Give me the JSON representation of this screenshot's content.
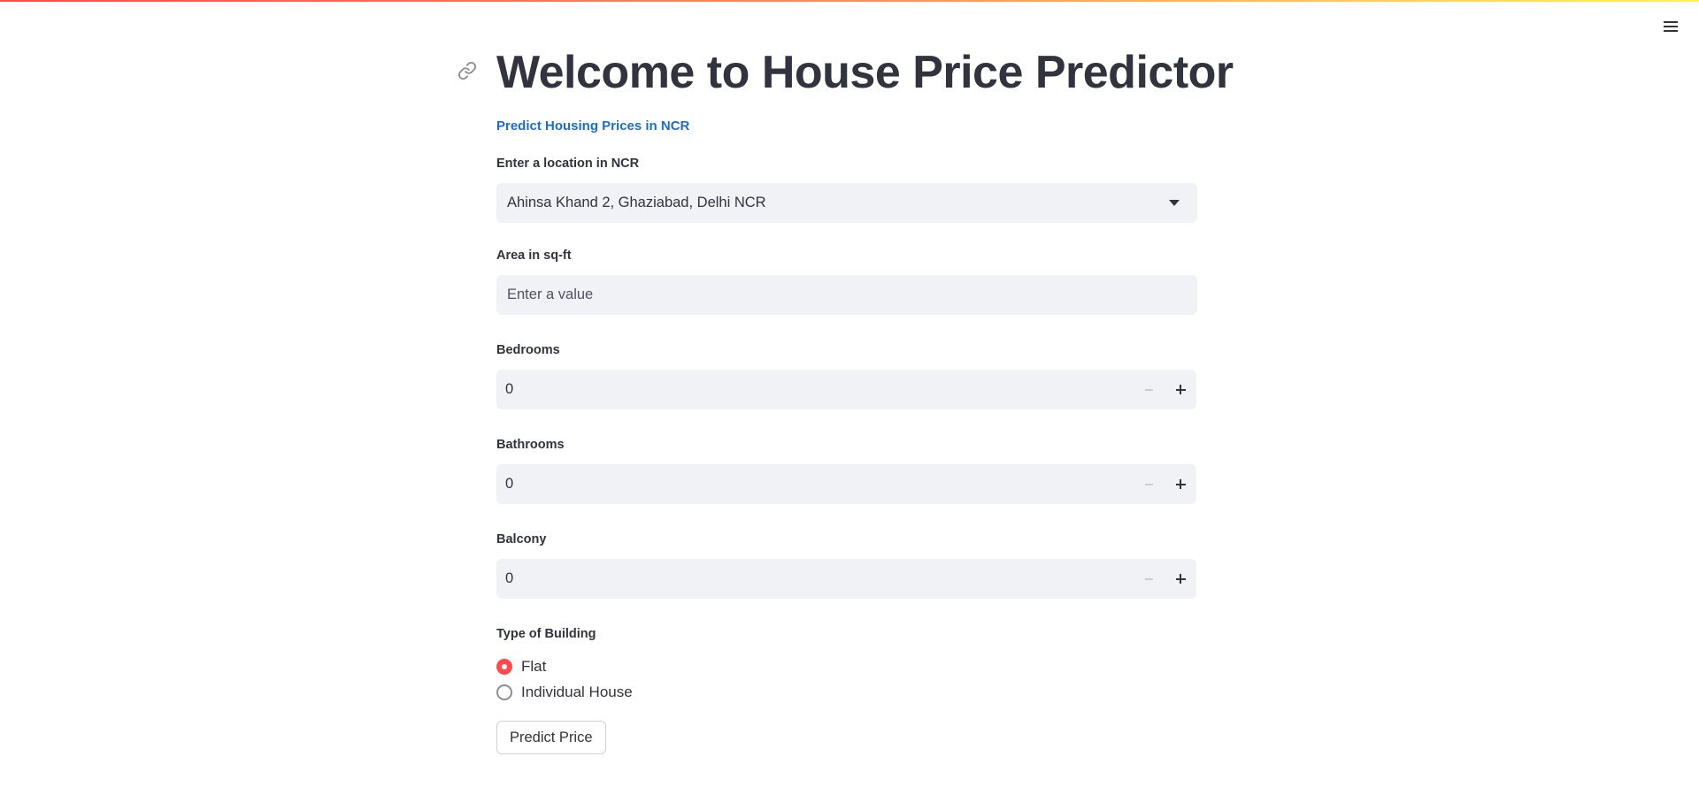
{
  "app": {
    "title": "Welcome to House Price Predictor",
    "subtitle": "Predict Housing Prices in NCR",
    "accent_color": "#ff4b4b",
    "subtitle_color": "#1a6fc4"
  },
  "header": {
    "menu_icon": "hamburger-menu-icon",
    "anchor_icon": "link-icon"
  },
  "form": {
    "location": {
      "label": "Enter a location in NCR",
      "selected": "Ahinsa Khand 2, Ghaziabad, Delhi NCR"
    },
    "area": {
      "label": "Area in sq-ft",
      "value": "",
      "placeholder": "Enter a value"
    },
    "bedrooms": {
      "label": "Bedrooms",
      "value": "0"
    },
    "bathrooms": {
      "label": "Bathrooms",
      "value": "0"
    },
    "balcony": {
      "label": "Balcony",
      "value": "0"
    },
    "building_type": {
      "label": "Type of Building",
      "options": [
        {
          "label": "Flat",
          "checked": true
        },
        {
          "label": "Individual House",
          "checked": false
        }
      ]
    },
    "submit_label": "Predict Price"
  }
}
